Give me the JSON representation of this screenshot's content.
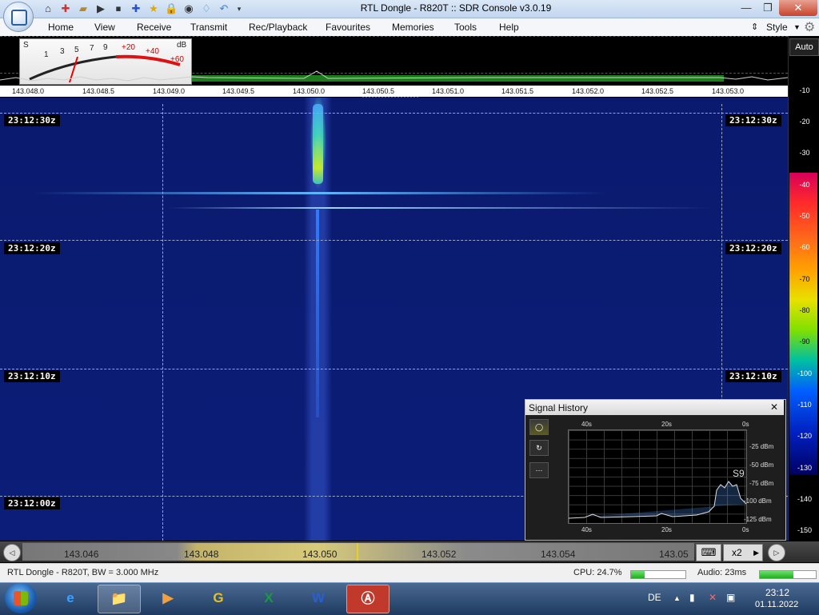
{
  "window": {
    "title": "RTL Dongle - R820T :: SDR Console v3.0.19",
    "controls": {
      "minimize": "—",
      "restore": "❐",
      "close": "✕"
    }
  },
  "quick_access": [
    "⌂",
    "✚",
    "▰",
    "▶",
    "⏹",
    "✚",
    "★",
    "🔒",
    "◉",
    "♢",
    "↶"
  ],
  "menu": {
    "items": [
      "Home",
      "View",
      "Receive",
      "Transmit",
      "Rec/Playback",
      "Favourites",
      "Memories",
      "Tools",
      "Help"
    ],
    "style_label": "Style"
  },
  "smeter": {
    "labels": [
      "S",
      "1",
      "3",
      "5",
      "7",
      "9",
      "+20",
      "+40",
      "+60",
      "dB"
    ]
  },
  "freq_axis": {
    "labels": [
      "143.048.0",
      "143.048.5",
      "143.049.0",
      "143.049.5",
      "143.050.0",
      "143.050.5",
      "143.051.0",
      "143.051.5",
      "143.052.0",
      "143.052.5",
      "143.053.0"
    ]
  },
  "waterfall": {
    "timestamps": [
      "23:12:30z",
      "23:12:20z",
      "23:12:10z",
      "23:12:00z"
    ]
  },
  "scale": {
    "auto_label": "Auto",
    "labels": [
      "-10",
      "-20",
      "-30",
      "-40",
      "-50",
      "-60",
      "-70",
      "-80",
      "-90",
      "-100",
      "-110",
      "-120",
      "-130",
      "-140",
      "-150"
    ]
  },
  "nav": {
    "labels": [
      "143.046",
      "143.048",
      "143.050",
      "143.052",
      "143.054",
      "143.05"
    ],
    "zoom": "x2",
    "prev_icon": "◁",
    "next_icon": "▷",
    "keyboard_icon": "⌨"
  },
  "signal_history": {
    "title": "Signal History",
    "close": "✕",
    "time_labels_top": [
      "40s",
      "20s",
      "0s"
    ],
    "time_labels_bottom": [
      "40s",
      "20s",
      "0s"
    ],
    "level_labels": [
      "-25 dBm",
      "-50 dBm",
      "-75 dBm",
      "-100 dBm",
      "-125 dBm"
    ],
    "peak_label": "S9"
  },
  "status": {
    "device": "RTL Dongle - R820T, BW = 3.000 MHz",
    "cpu": "CPU: 24.7%",
    "cpu_fraction": 0.247,
    "audio": "Audio: 23ms",
    "audio_fraction": 0.6
  },
  "taskbar": {
    "apps": [
      "e",
      "📁",
      "▶",
      "G",
      "X",
      "W",
      "Ⓐ"
    ],
    "lang": "DE",
    "time": "23:12",
    "date": "01.11.2022"
  },
  "colors": {
    "waterfall_bg": "#0b1d78",
    "spectrum_green": "#1d7d1d",
    "accent_close": "#c8432b"
  }
}
